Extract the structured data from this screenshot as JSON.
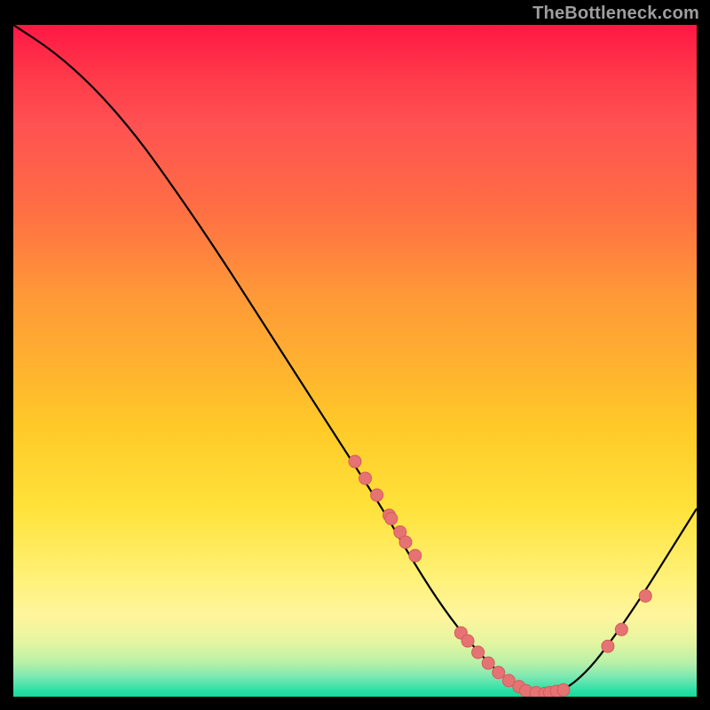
{
  "watermark": "TheBottleneck.com",
  "colors": {
    "curve": "#000000",
    "points_fill": "#e57373",
    "points_stroke": "#d85a5a"
  },
  "chart_data": {
    "type": "line",
    "title": "",
    "xlabel": "",
    "ylabel": "",
    "xlim": [
      0,
      100
    ],
    "ylim": [
      0,
      100
    ],
    "grid": false,
    "series": [
      {
        "name": "bottleneck-curve",
        "x": [
          0,
          6,
          12,
          18,
          24,
          30,
          36,
          42,
          48,
          54,
          58,
          62,
          66,
          70,
          73,
          76,
          80,
          84,
          88,
          92,
          96,
          100
        ],
        "y": [
          100,
          96,
          90.5,
          83.5,
          75,
          66,
          56.5,
          47,
          37.5,
          28,
          21,
          14.5,
          9,
          4.5,
          2,
          0.5,
          0.5,
          3.7,
          9,
          15,
          21.5,
          28
        ]
      }
    ],
    "scatter": [
      {
        "name": "marked-points",
        "x": [
          50.0,
          51.5,
          53.2,
          55.0,
          55.3,
          56.6,
          57.4,
          58.8,
          65.5,
          66.5,
          68.0,
          69.5,
          71.0,
          72.5,
          74.0,
          75.0,
          76.5,
          77.8,
          78.5,
          79.5,
          80.5,
          87.0,
          89.0,
          92.5
        ],
        "y": [
          35.0,
          32.5,
          30.0,
          27.0,
          26.5,
          24.5,
          23.0,
          21.0,
          9.5,
          8.3,
          6.6,
          5.0,
          3.6,
          2.4,
          1.5,
          0.9,
          0.6,
          0.5,
          0.6,
          0.8,
          1.0,
          7.5,
          10.0,
          15.0
        ]
      }
    ]
  }
}
